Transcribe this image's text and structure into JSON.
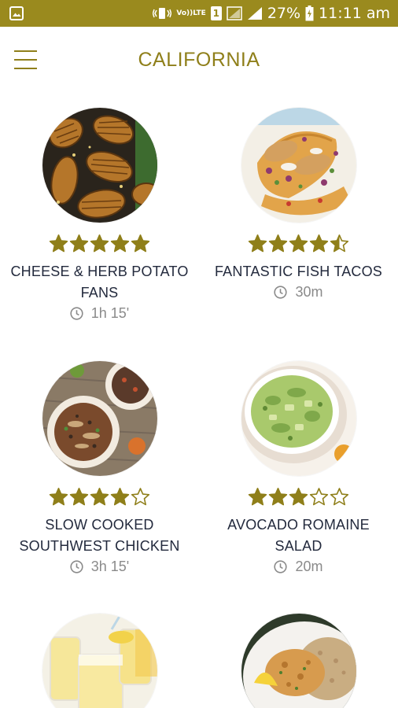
{
  "status_bar": {
    "sim_badge": "1",
    "volte_top": "Vo))",
    "volte_bottom": "LTE",
    "battery": "27%",
    "time": "11:11 am"
  },
  "header": {
    "title": "CALIFORNIA"
  },
  "recipes": [
    {
      "name": "CHEESE & HERB POTATO FANS",
      "time": "1h 15'",
      "rating": 5,
      "photo_icon": "potato-fans-photo"
    },
    {
      "name": "FANTASTIC FISH TACOS",
      "time": "30m",
      "rating": 4.5,
      "photo_icon": "fish-tacos-photo"
    },
    {
      "name": "SLOW COOKED SOUTHWEST CHICKEN",
      "time": "3h 15'",
      "rating": 4,
      "photo_icon": "southwest-chicken-photo"
    },
    {
      "name": "AVOCADO ROMAINE SALAD",
      "time": "20m",
      "rating": 3,
      "photo_icon": "romaine-salad-photo"
    },
    {
      "name": "",
      "time": "",
      "rating": null,
      "photo_icon": "lemonade-photo"
    },
    {
      "name": "",
      "time": "",
      "rating": null,
      "photo_icon": "chicken-rice-photo"
    }
  ],
  "colors": {
    "accent": "#9a8a1e",
    "title": "#8f7f1a",
    "star": "#8f7f1a",
    "text": "#232a3d",
    "muted": "#8a8a8a"
  }
}
